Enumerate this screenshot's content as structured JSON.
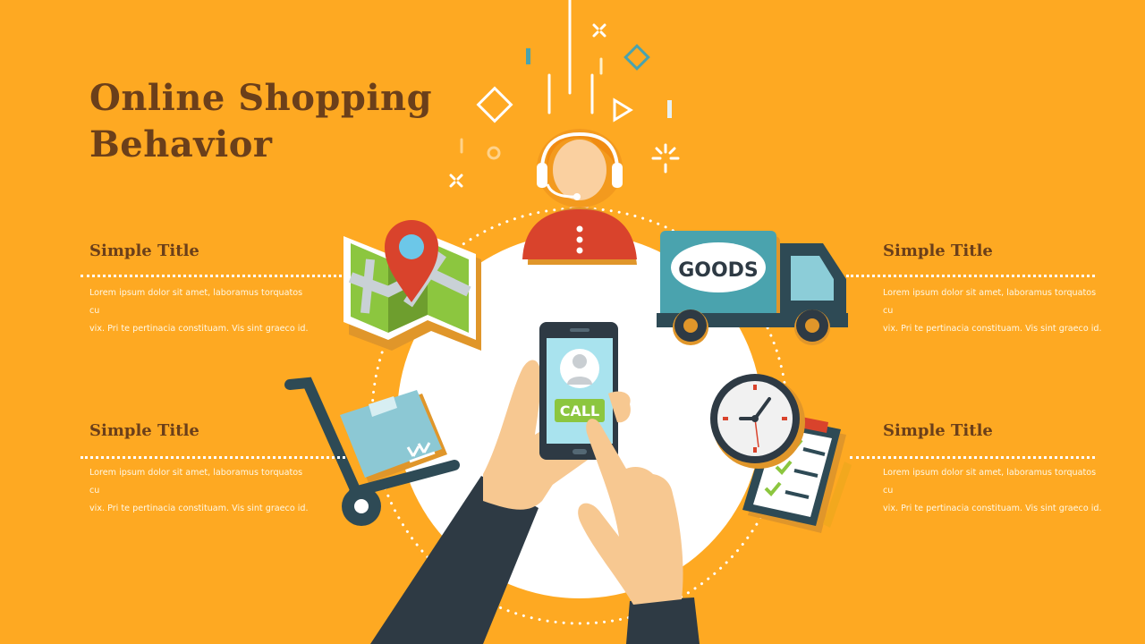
{
  "slide": {
    "title_line1": "Online Shopping",
    "title_line2": "Behavior"
  },
  "sections": [
    {
      "title": "Simple Title",
      "text_line1": "Lorem ipsum dolor sit amet, laboramus torquatos cu",
      "text_line2": "vix. Pri te pertinacia constituam. Vis sint graeco id."
    },
    {
      "title": "Simple Title",
      "text_line1": "Lorem ipsum dolor sit amet, laboramus torquatos cu",
      "text_line2": "vix. Pri te pertinacia constituam. Vis sint graeco id."
    },
    {
      "title": "Simple Title",
      "text_line1": "Lorem ipsum dolor sit amet, laboramus torquatos cu",
      "text_line2": "vix. Pri te pertinacia constituam. Vis sint graeco id."
    },
    {
      "title": "Simple Title",
      "text_line1": "Lorem ipsum dolor sit amet, laboramus torquatos cu",
      "text_line2": "vix. Pri te pertinacia constituam. Vis sint graeco id."
    }
  ],
  "truck": {
    "label": "GOODS"
  },
  "phone": {
    "button_label": "CALL"
  },
  "colors": {
    "background": "#FEA922",
    "title": "#6B3F1A",
    "teal": "#4AA3AE",
    "dark": "#2E3A44",
    "red": "#D9432C",
    "green": "#8CC63F"
  },
  "icons": [
    "customer-support-icon",
    "map-pin-icon",
    "delivery-truck-icon",
    "hand-truck-box-icon",
    "clock-icon",
    "clipboard-checklist-icon",
    "smartphone-icon"
  ]
}
